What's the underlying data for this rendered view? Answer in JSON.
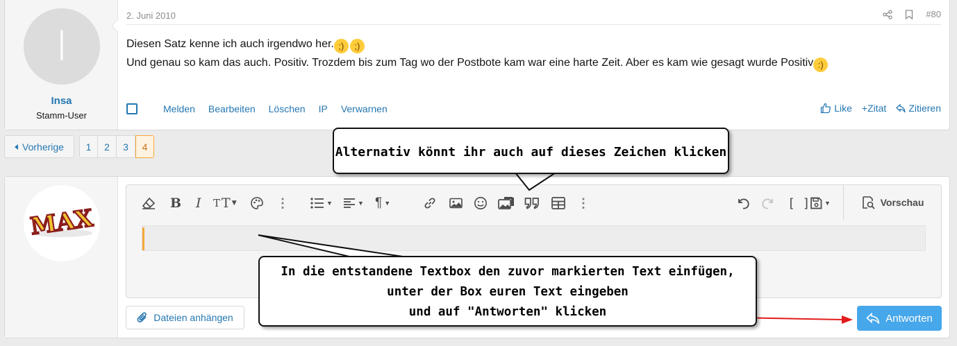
{
  "post": {
    "date": "2. Juni 2010",
    "number": "#80",
    "author": "Insa",
    "author_initial": "I",
    "user_title": "Stamm-User",
    "line1": "Diesen Satz kenne ich auch irgendwo her.",
    "line2": "Und genau so kam das auch. Positiv. Trozdem bis zum Tag wo der Postbote kam war eine harte Zeit. Aber es kam wie gesagt wurde Positiv",
    "links": [
      "Melden",
      "Bearbeiten",
      "Löschen",
      "IP",
      "Verwarnen"
    ],
    "like": "Like",
    "zitat": "+Zitat",
    "zitieren": "Zitieren"
  },
  "pagination": {
    "prev": "Vorherige",
    "pages": [
      "1",
      "2",
      "3",
      "4"
    ],
    "current": "4"
  },
  "reply": {
    "avatar_text": "MAX",
    "preview": "Vorschau",
    "attach": "Dateien anhängen",
    "submit": "Antworten"
  },
  "callouts": {
    "top": "Alternativ könnt ihr auch auf dieses Zeichen klicken",
    "bottom_l1": "In die entstandene Textbox den zuvor markierten Text einfügen,",
    "bottom_l2": "unter der Box euren Text eingeben",
    "bottom_l3": "und auf \"Antworten\" klicken"
  },
  "colors": {
    "link": "#2577b1",
    "accent": "#f7a836",
    "button": "#47a7eb",
    "arrow": "#e31b1b"
  },
  "icons": [
    "share-icon",
    "bookmark-icon",
    "eraser-icon",
    "bold-icon",
    "italic-icon",
    "text-size-icon",
    "palette-icon",
    "more-icon",
    "list-icon",
    "align-icon",
    "paragraph-icon",
    "link-icon",
    "image-icon",
    "smilie-icon",
    "media-icon",
    "quote-icon",
    "table-icon",
    "undo-icon",
    "redo-icon",
    "bbcode-icon",
    "drafts-icon",
    "preview-icon",
    "paperclip-icon",
    "reply-icon",
    "thumbs-up-icon"
  ]
}
